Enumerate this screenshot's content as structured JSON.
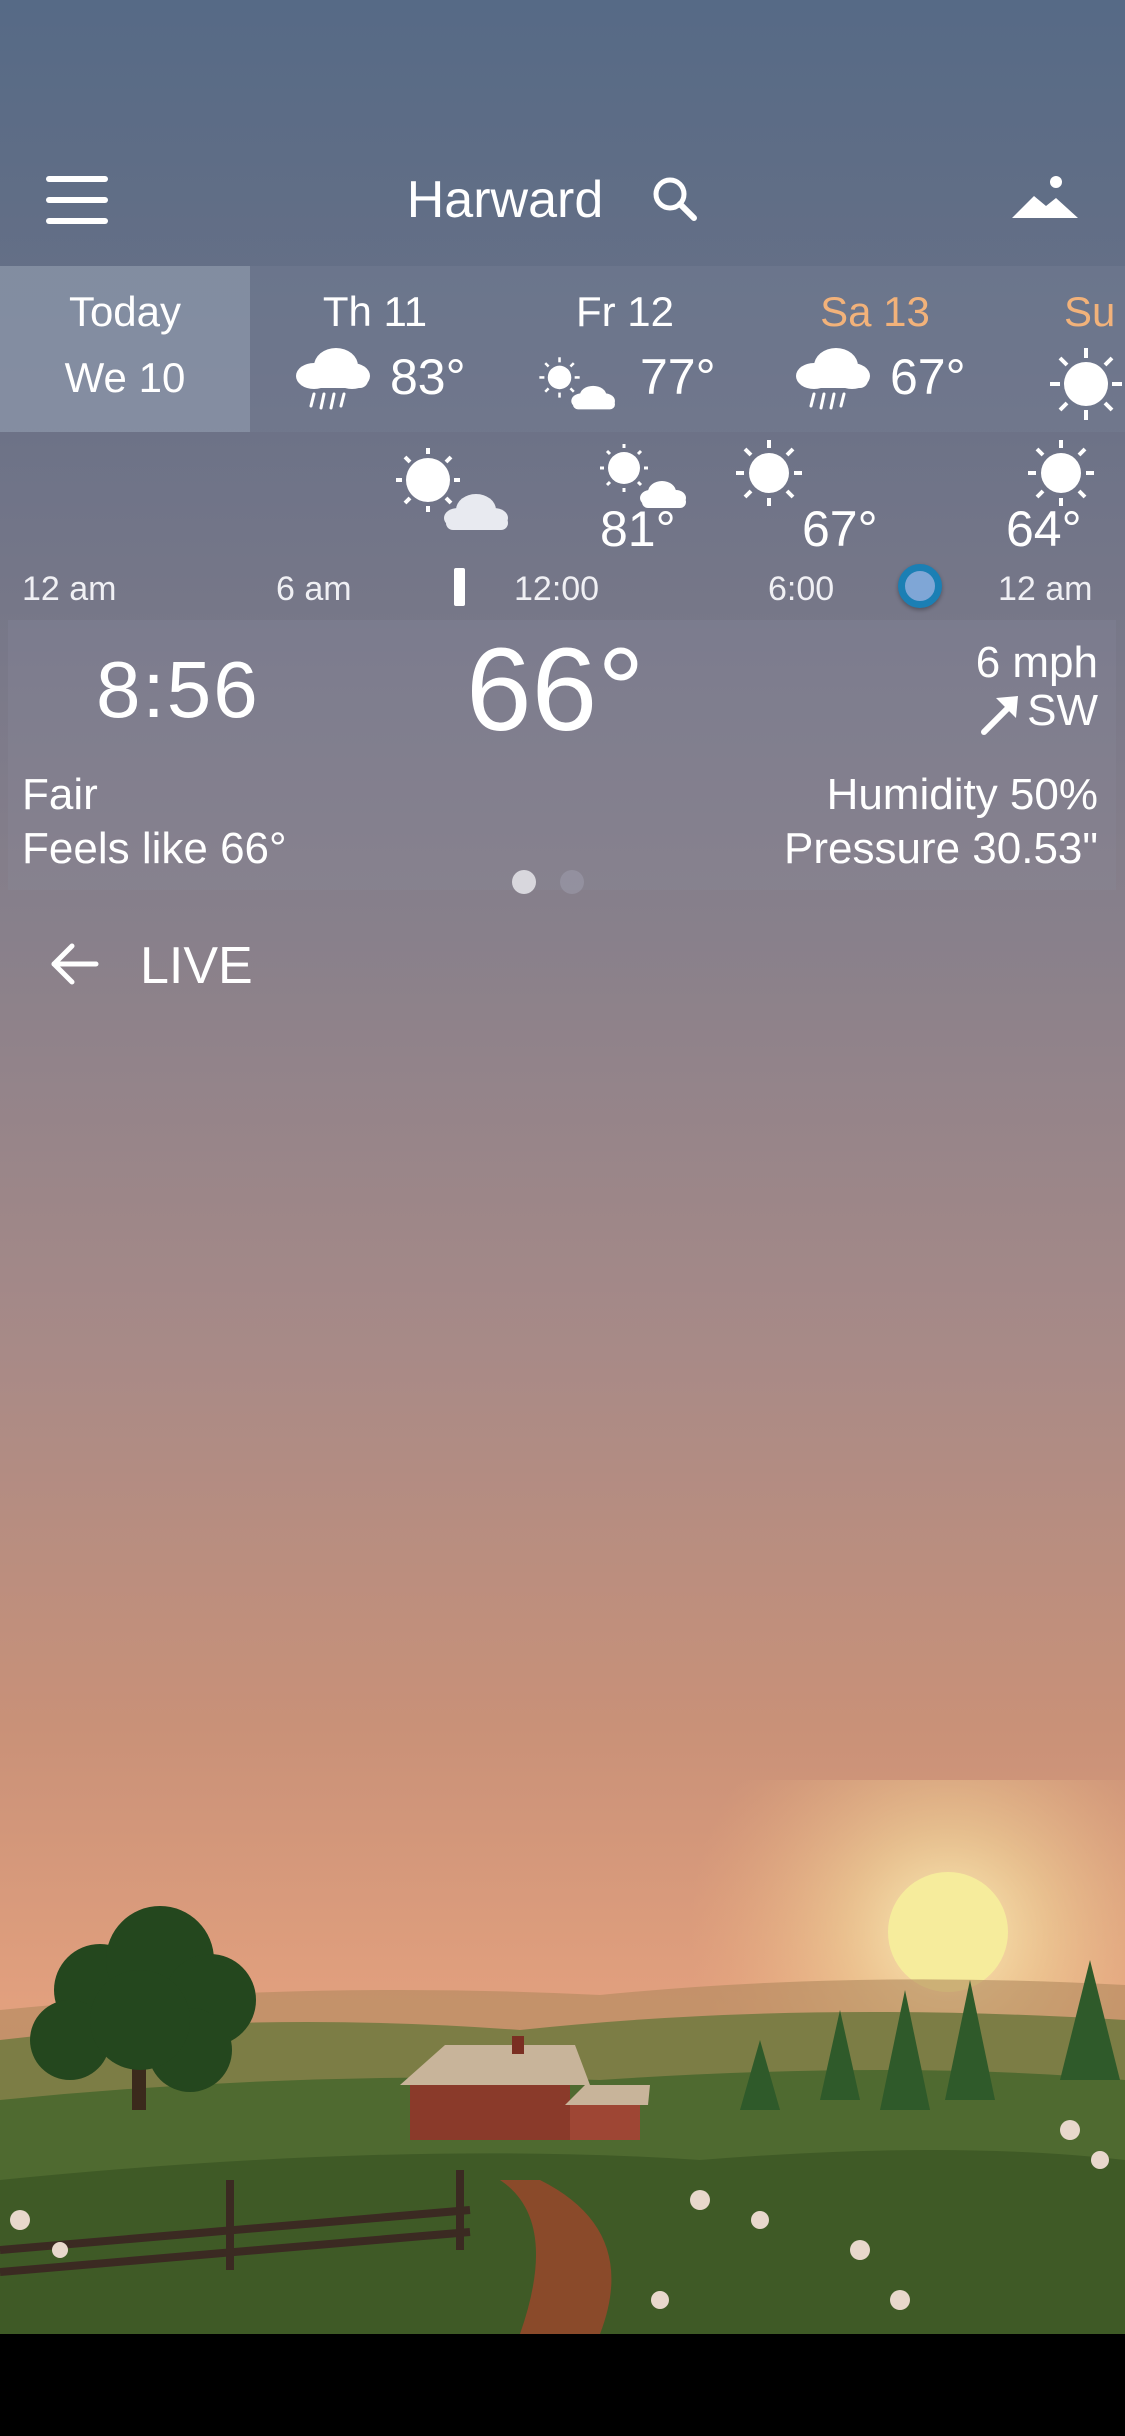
{
  "header": {
    "city": "Harward",
    "menu_icon": "hamburger-menu-icon",
    "search_icon": "search-icon",
    "background_icon": "mountain-landscape-icon"
  },
  "days": {
    "today": {
      "line1": "Today",
      "line2": "We 10"
    },
    "items": [
      {
        "name": "Th 11",
        "temp": "83°",
        "icon": "rain-cloud-icon"
      },
      {
        "name": "Fr 12",
        "temp": "77°",
        "icon": "sun-cloud-icon"
      },
      {
        "name": "Sa 13",
        "temp": "67°",
        "icon": "rain-cloud-icon"
      },
      {
        "name": "Su",
        "temp": "",
        "icon": "sun-icon"
      }
    ],
    "weekend_color": "#f2b27a"
  },
  "hourly": {
    "temps": [
      "81°",
      "67°",
      "64°"
    ],
    "icons": [
      "sun-cloud-icon",
      "sun-cloud-icon",
      "sun-icon",
      "sun-icon"
    ],
    "times": [
      "12 am",
      "6 am",
      "12:00",
      "6:00",
      "12 am"
    ]
  },
  "current": {
    "time": "8:56",
    "temp": "66°",
    "wind_speed": "6 mph",
    "wind_dir": "SW",
    "condition": "Fair",
    "feels_like": "Feels like 66°",
    "humidity": "Humidity 50%",
    "pressure": "Pressure 30.53\""
  },
  "pager": {
    "pages": 2,
    "active": 1
  },
  "live": {
    "label": "LIVE"
  },
  "colors": {
    "accent_dot": "#1b7fb4",
    "dot_fill": "#7fa6d6"
  }
}
